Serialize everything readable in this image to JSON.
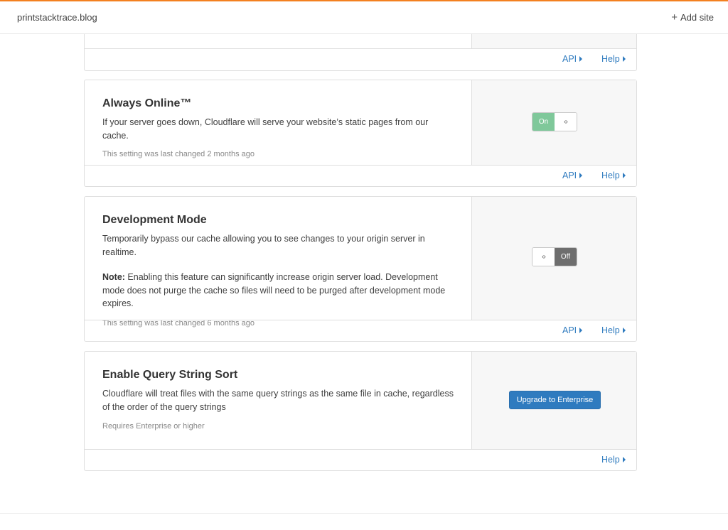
{
  "header": {
    "site_name": "printstacktrace.blog",
    "add_site_label": "Add site",
    "add_site_icon": "+"
  },
  "links": {
    "api": "API",
    "help": "Help"
  },
  "cards": {
    "always_online": {
      "title": "Always Online™",
      "description": "If your server goes down, Cloudflare will serve your website’s static pages from our cache.",
      "meta": "This setting was last changed 2 months ago",
      "toggle_state_label": "On",
      "toggle_handle": "‹›"
    },
    "dev_mode": {
      "title": "Development Mode",
      "description": "Temporarily bypass our cache allowing you to see changes to your origin server in realtime.",
      "note_label": "Note:",
      "note_text": " Enabling this feature can significantly increase origin server load. Development mode does not purge the cache so files will need to be purged after development mode expires.",
      "meta": "This setting was last changed 6 months ago",
      "toggle_state_label": "Off",
      "toggle_handle": "‹›"
    },
    "query_sort": {
      "title": "Enable Query String Sort",
      "description": "Cloudflare will treat files with the same query strings as the same file in cache, regardless of the order of the query strings",
      "meta": "Requires Enterprise or higher",
      "button_label": "Upgrade to Enterprise"
    }
  },
  "colors": {
    "accent_orange": "#f38020",
    "link_blue": "#2f7bbf",
    "toggle_on": "#7fc89a",
    "toggle_off": "#6e6e6e"
  }
}
